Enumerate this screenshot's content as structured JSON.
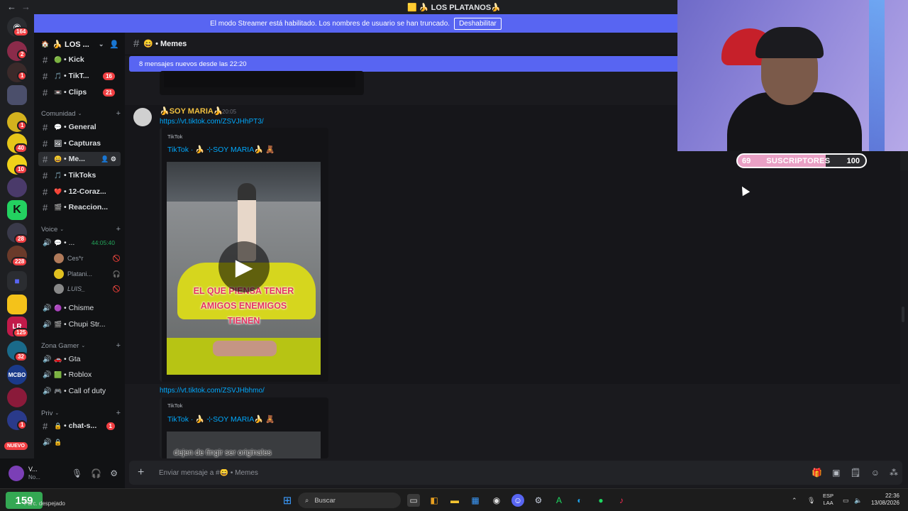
{
  "window": {
    "title": "🟨 🍌 LOS PLATANOS🍌"
  },
  "rail": {
    "badges": [
      "164",
      "2",
      "1",
      "1",
      "40",
      "10",
      "28",
      "228",
      "125",
      "32",
      "1"
    ],
    "nuevo_label": "NUEVO"
  },
  "banner": {
    "text": "El modo Streamer está habilitado. Los nombres de usuario se han truncado.",
    "button_label": "Deshabilitar"
  },
  "server": {
    "name": "🍌 LOS ...",
    "channels_top": [
      {
        "name": "• Kick",
        "emoji": "🟢",
        "badge": ""
      },
      {
        "name": "• TikT...",
        "emoji": "🎵",
        "badge": "16"
      },
      {
        "name": "• Clips",
        "emoji": "📼",
        "badge": "21"
      }
    ],
    "category_comunidad": "Comunidad",
    "channels_comunidad": [
      {
        "name": "• General",
        "emoji": "💬"
      },
      {
        "name": "• Capturas",
        "emoji": "🖼"
      },
      {
        "name": "• Me...",
        "emoji": "😄"
      },
      {
        "name": "• TikToks",
        "emoji": "🎵"
      },
      {
        "name": "• 12-Coraz...",
        "emoji": "❤️"
      },
      {
        "name": "• Reaccion...",
        "emoji": "🎬"
      }
    ],
    "category_voice": "Voice",
    "voice_channel": {
      "name": "• ...",
      "timer": "44:05:40"
    },
    "voice_users": [
      "Ces*r",
      "Platani...",
      "LUIS_"
    ],
    "voice_channels": [
      {
        "name": "• Chisme",
        "emoji": "🟣"
      },
      {
        "name": "• Chupi Str...",
        "emoji": "🎬"
      }
    ],
    "category_gamer": "Zona Gamer",
    "gamer_channels": [
      {
        "name": "• Gta",
        "emoji": "🚗"
      },
      {
        "name": "• Roblox",
        "emoji": "🟩"
      },
      {
        "name": "• Call of duty",
        "emoji": "🎮"
      }
    ],
    "category_priv": "Priv",
    "priv_channels": [
      {
        "name": "• chat-s...",
        "emoji": "🔒",
        "badge": "1"
      },
      {
        "name": "",
        "emoji": "🔒"
      }
    ]
  },
  "user": {
    "name": "V...",
    "status": "No..."
  },
  "channel": {
    "name": "😄 • Memes",
    "new_messages": "8 mensajes nuevos desde las 22:20"
  },
  "message": {
    "author": "🍌SOY MARIA🍌",
    "time": "20:05",
    "link1": "https://vt.tiktok.com/ZSVJHhPT3/",
    "embed1": {
      "provider": "TikTok",
      "title": "TikTok · 🍌 ⊹SOY MARIA🍌 🧸"
    },
    "video_caption": [
      "EL QUE PIENSA TENER",
      "AMIGOS ENEMIGOS",
      "TIENEN"
    ],
    "link2": "https://vt.tiktok.com/ZSVJHbhmo/",
    "embed2": {
      "provider": "TikTok",
      "title": "TikTok · 🍌 ⊹SOY MARIA🍌 🧸"
    },
    "video2_caption": "dejen de fingir ser originales"
  },
  "composer": {
    "placeholder": "Enviar mensaje a #😄 • Memes"
  },
  "overlay": {
    "sub_current": "69",
    "sub_label": "SUSCRIPTORES",
    "sub_goal": "100",
    "sub_progress": 0.69
  },
  "taskbar": {
    "weather_value": "159",
    "weather_text": "Parc. despejado",
    "search_placeholder": "Buscar",
    "lang_top": "ESP",
    "lang_bottom": "LAA",
    "time": "22:36",
    "date": "13/08/2026"
  },
  "colors": {
    "blurple": "#5865f2",
    "link": "#00a8fc",
    "badge_red": "#f23f43",
    "author_gold": "#f0c040",
    "sub_pink": "#e9a0c5"
  }
}
